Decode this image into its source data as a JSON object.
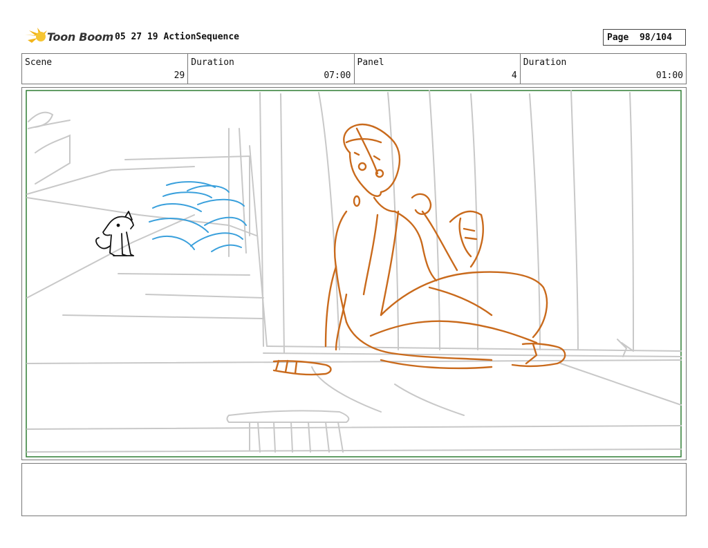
{
  "header": {
    "logo_text": "Toon Boom",
    "sequence_title": "05 27 19 ActionSequence",
    "page_label": "Page",
    "page_value": "98/104"
  },
  "info": [
    {
      "label": "Scene",
      "value": "29"
    },
    {
      "label": "Duration",
      "value": "07:00"
    },
    {
      "label": "Panel",
      "value": "4"
    },
    {
      "label": "Duration",
      "value": "01:00"
    }
  ],
  "colors": {
    "safe_frame": "#2e7d32",
    "background_sketch": "#c8c8c8",
    "character": "#c96a1c",
    "effect": "#3aa0dc",
    "dog": "#111111"
  },
  "notes": ""
}
